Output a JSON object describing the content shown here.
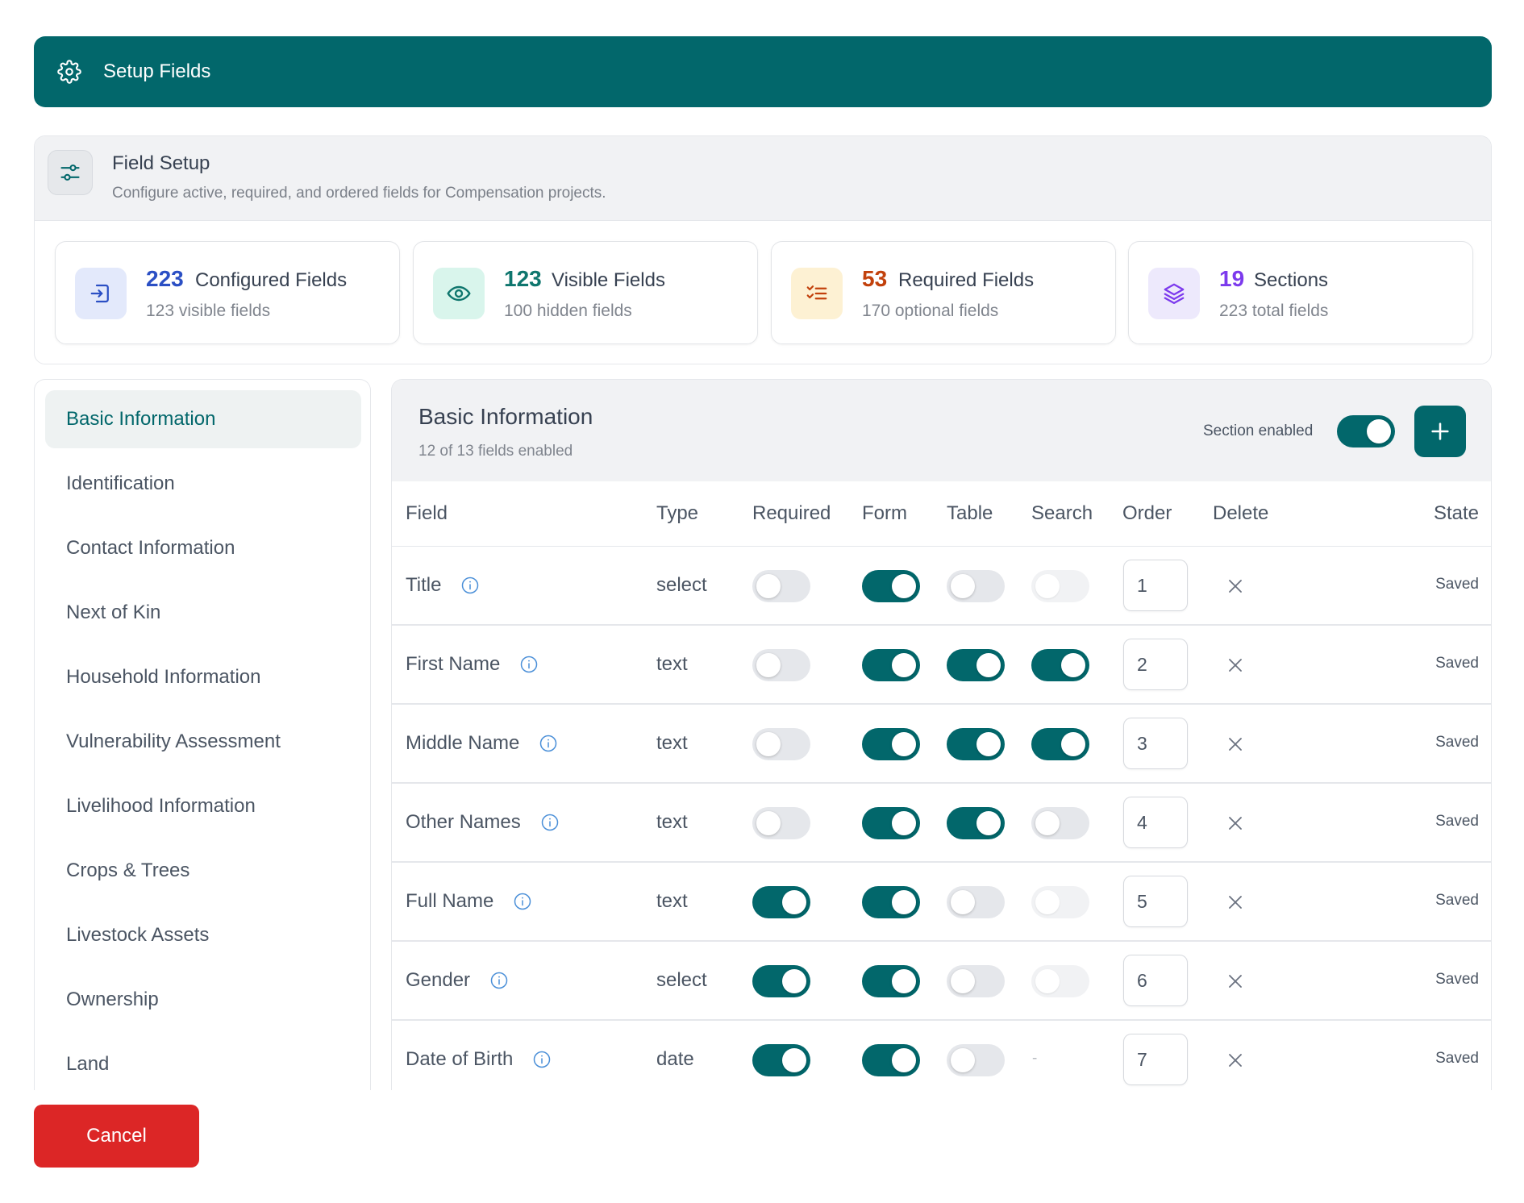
{
  "header": {
    "title": "Setup Fields",
    "icon": "gear-icon"
  },
  "setup": {
    "title": "Field Setup",
    "subtitle": "Configure active, required, and ordered fields for Compensation projects."
  },
  "stats": [
    {
      "number": "223",
      "label": "Configured Fields",
      "sub": "123 visible fields",
      "icon": "import-icon",
      "color": "#2b4fc4",
      "bg": "#e3e9fb"
    },
    {
      "number": "123",
      "label": "Visible Fields",
      "sub": "100 hidden fields",
      "icon": "eye-icon",
      "color": "#0f766e",
      "bg": "#d9f5ec"
    },
    {
      "number": "53",
      "label": "Required Fields",
      "sub": "170 optional fields",
      "icon": "checklist-icon",
      "color": "#c2410c",
      "bg": "#fdf1d3"
    },
    {
      "number": "19",
      "label": "Sections",
      "sub": "223 total fields",
      "icon": "layers-icon",
      "color": "#7c3aed",
      "bg": "#ede9fc"
    }
  ],
  "nav": {
    "items": [
      "Basic Information",
      "Identification",
      "Contact Information",
      "Next of Kin",
      "Household Information",
      "Vulnerability Assessment",
      "Livelihood Information",
      "Crops & Trees",
      "Livestock Assets",
      "Ownership",
      "Land"
    ],
    "active_index": 0
  },
  "section": {
    "title": "Basic Information",
    "subtitle": "12 of 13 fields enabled",
    "enabled_label": "Section enabled",
    "enabled": true
  },
  "table": {
    "headers": {
      "field": "Field",
      "type": "Type",
      "required": "Required",
      "form": "Form",
      "table": "Table",
      "search": "Search",
      "order": "Order",
      "delete": "Delete",
      "state": "State"
    },
    "rows": [
      {
        "field": "Title",
        "type": "select",
        "required": "off",
        "form": "on",
        "table": "off",
        "search": "disabled",
        "order": "1",
        "state": "Saved"
      },
      {
        "field": "First Name",
        "type": "text",
        "required": "off",
        "form": "on",
        "table": "on",
        "search": "on",
        "order": "2",
        "state": "Saved"
      },
      {
        "field": "Middle Name",
        "type": "text",
        "required": "off",
        "form": "on",
        "table": "on",
        "search": "on",
        "order": "3",
        "state": "Saved"
      },
      {
        "field": "Other Names",
        "type": "text",
        "required": "off",
        "form": "on",
        "table": "on",
        "search": "off",
        "order": "4",
        "state": "Saved"
      },
      {
        "field": "Full Name",
        "type": "text",
        "required": "on",
        "form": "on",
        "table": "off",
        "search": "disabled",
        "order": "5",
        "state": "Saved"
      },
      {
        "field": "Gender",
        "type": "select",
        "required": "on",
        "form": "on",
        "table": "off",
        "search": "disabled",
        "order": "6",
        "state": "Saved"
      },
      {
        "field": "Date of Birth",
        "type": "date",
        "required": "on",
        "form": "on",
        "table": "off",
        "search": "-",
        "order": "7",
        "state": "Saved"
      }
    ]
  },
  "footer": {
    "cancel_label": "Cancel"
  },
  "colors": {
    "primary": "#02676b",
    "danger": "#dc2626",
    "info": "#4a8fd8"
  }
}
